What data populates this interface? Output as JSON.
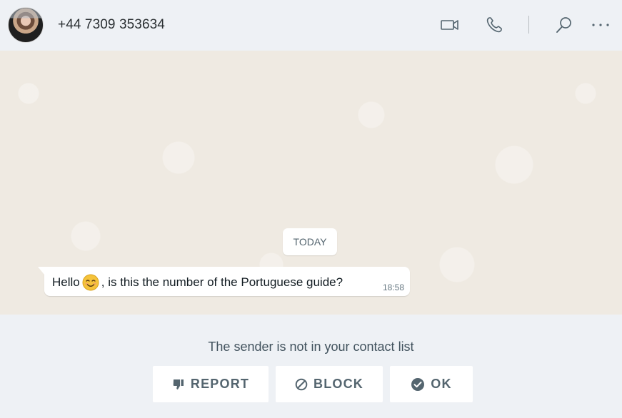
{
  "header": {
    "contact_name": "+44 7309 353634",
    "icons": [
      "video-call-icon",
      "voice-call-icon",
      "search-icon",
      "more-options-icon"
    ]
  },
  "chat": {
    "date_label": "TODAY",
    "messages": [
      {
        "text_before": "Hello",
        "emoji": "smiling-face-icon",
        "text_after": ", is this the number of the Portuguese guide?",
        "time": "18:58"
      }
    ]
  },
  "footer": {
    "notice": "The sender is not in your contact list",
    "report_label": "REPORT",
    "block_label": "BLOCK",
    "ok_label": "OK"
  },
  "colors": {
    "header_bg": "#eef1f5",
    "chat_bg": "#efeae2",
    "bubble_bg": "#ffffff",
    "icon": "#54656f",
    "text": "#111b21"
  }
}
